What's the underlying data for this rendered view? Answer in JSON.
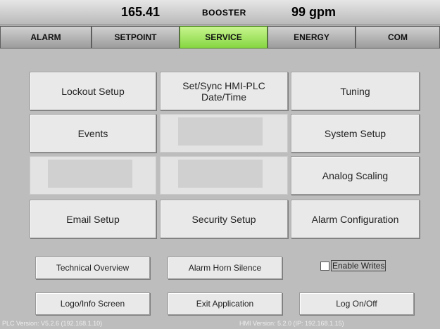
{
  "header": {
    "value_left": "165.41",
    "title": "BOOSTER",
    "value_right": "99 gpm"
  },
  "tabs": [
    {
      "label": "ALARM",
      "active": false
    },
    {
      "label": "SETPOINT",
      "active": false
    },
    {
      "label": "SERVICE",
      "active": true
    },
    {
      "label": "ENERGY",
      "active": false
    },
    {
      "label": "COM",
      "active": false
    }
  ],
  "grid": {
    "lockout_setup": "Lockout Setup",
    "set_sync": "Set/Sync HMI-PLC Date/Time",
    "tuning": "Tuning",
    "events": "Events",
    "system_setup": "System Setup",
    "analog_scaling": "Analog Scaling",
    "email_setup": "Email Setup",
    "security_setup": "Security Setup",
    "alarm_configuration": "Alarm Configuration"
  },
  "bottom": {
    "technical_overview": "Technical Overview",
    "alarm_horn_silence": "Alarm Horn Silence",
    "enable_writes": "Enable Writes",
    "enable_writes_checked": false,
    "logo_info": "Logo/Info Screen",
    "exit_application": "Exit Application",
    "log_on_off": "Log On/Off"
  },
  "footer": {
    "plc_version": "PLC Version: V5.2.6  (192.168.1.10)",
    "hmi_version": "HMI Version: 5.2.0 (IP: 192.168.1.15)"
  },
  "colors": {
    "active_tab": "#86d642",
    "background": "#bdbdbd"
  }
}
